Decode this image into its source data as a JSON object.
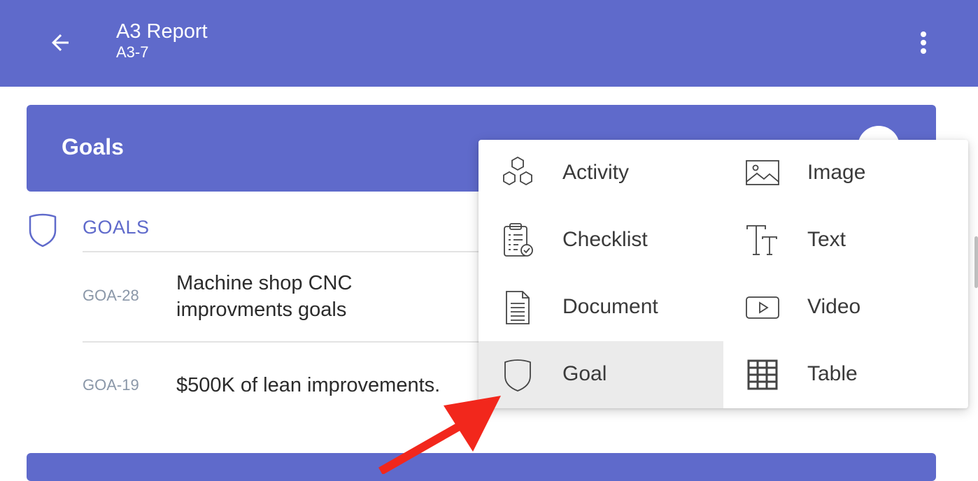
{
  "header": {
    "title": "A3 Report",
    "subtitle": "A3-7",
    "back_icon": "arrow-left-icon",
    "more_icon": "more-vertical-icon",
    "bg_color": "#5f6acb"
  },
  "section": {
    "title": "Goals"
  },
  "goals": {
    "heading": "GOALS",
    "items": [
      {
        "id": "GOA-28",
        "text_line1": "Machine shop CNC",
        "text_line2": "improvments goals"
      },
      {
        "id": "GOA-19",
        "text": "$500K of lean improvements."
      }
    ]
  },
  "menu": {
    "items": [
      {
        "label": "Activity",
        "icon": "hexagons-icon"
      },
      {
        "label": "Image",
        "icon": "image-icon"
      },
      {
        "label": "Checklist",
        "icon": "clipboard-check-icon"
      },
      {
        "label": "Text",
        "icon": "text-icon"
      },
      {
        "label": "Document",
        "icon": "document-icon"
      },
      {
        "label": "Video",
        "icon": "video-icon"
      },
      {
        "label": "Goal",
        "icon": "shield-icon",
        "highlighted": true
      },
      {
        "label": "Table",
        "icon": "table-grid-icon"
      }
    ]
  },
  "annotation": {
    "arrow_color": "#f2271c"
  }
}
